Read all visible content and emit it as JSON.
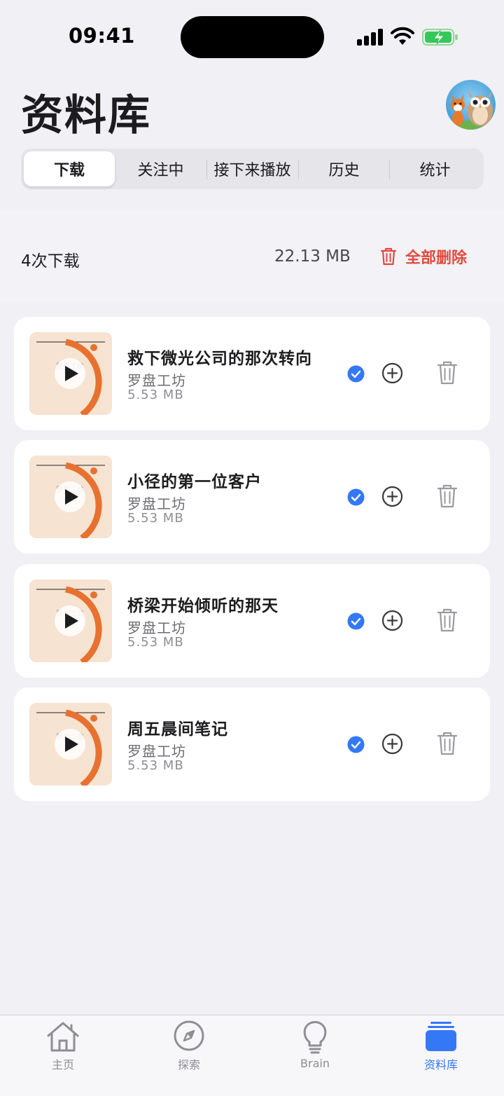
{
  "status_bar": {
    "time": "09:41"
  },
  "header": {
    "title": "资料库"
  },
  "segments": [
    {
      "label": "下载",
      "active": true
    },
    {
      "label": "关注中",
      "active": false
    },
    {
      "label": "接下来播放",
      "active": false
    },
    {
      "label": "历史",
      "active": false
    },
    {
      "label": "统计",
      "active": false
    }
  ],
  "summary": {
    "count": "4次下载",
    "total_size": "22.13 MB",
    "delete_all_label": "全部删除"
  },
  "downloads": [
    {
      "title": "救下微光公司的那次转向",
      "author": "罗盘工坊",
      "size": "5.53 MB"
    },
    {
      "title": "小径的第一位客户",
      "author": "罗盘工坊",
      "size": "5.53 MB"
    },
    {
      "title": "桥梁开始倾听的那天",
      "author": "罗盘工坊",
      "size": "5.53 MB"
    },
    {
      "title": "周五晨间笔记",
      "author": "罗盘工坊",
      "size": "5.53 MB"
    }
  ],
  "thumbnail": {
    "watermark": "罗盘工坊"
  },
  "tabbar": [
    {
      "label": "主页",
      "icon": "house-icon",
      "active": false
    },
    {
      "label": "探索",
      "icon": "compass-icon",
      "active": false
    },
    {
      "label": "Brain",
      "icon": "lightbulb-icon",
      "active": false
    },
    {
      "label": "资料库",
      "icon": "library-icon",
      "active": true
    }
  ],
  "colors": {
    "accent": "#3478f6",
    "destructive": "#e5483e",
    "thumbnail_bg": "#f6e3d2",
    "thumbnail_arc": "#e8712f"
  }
}
